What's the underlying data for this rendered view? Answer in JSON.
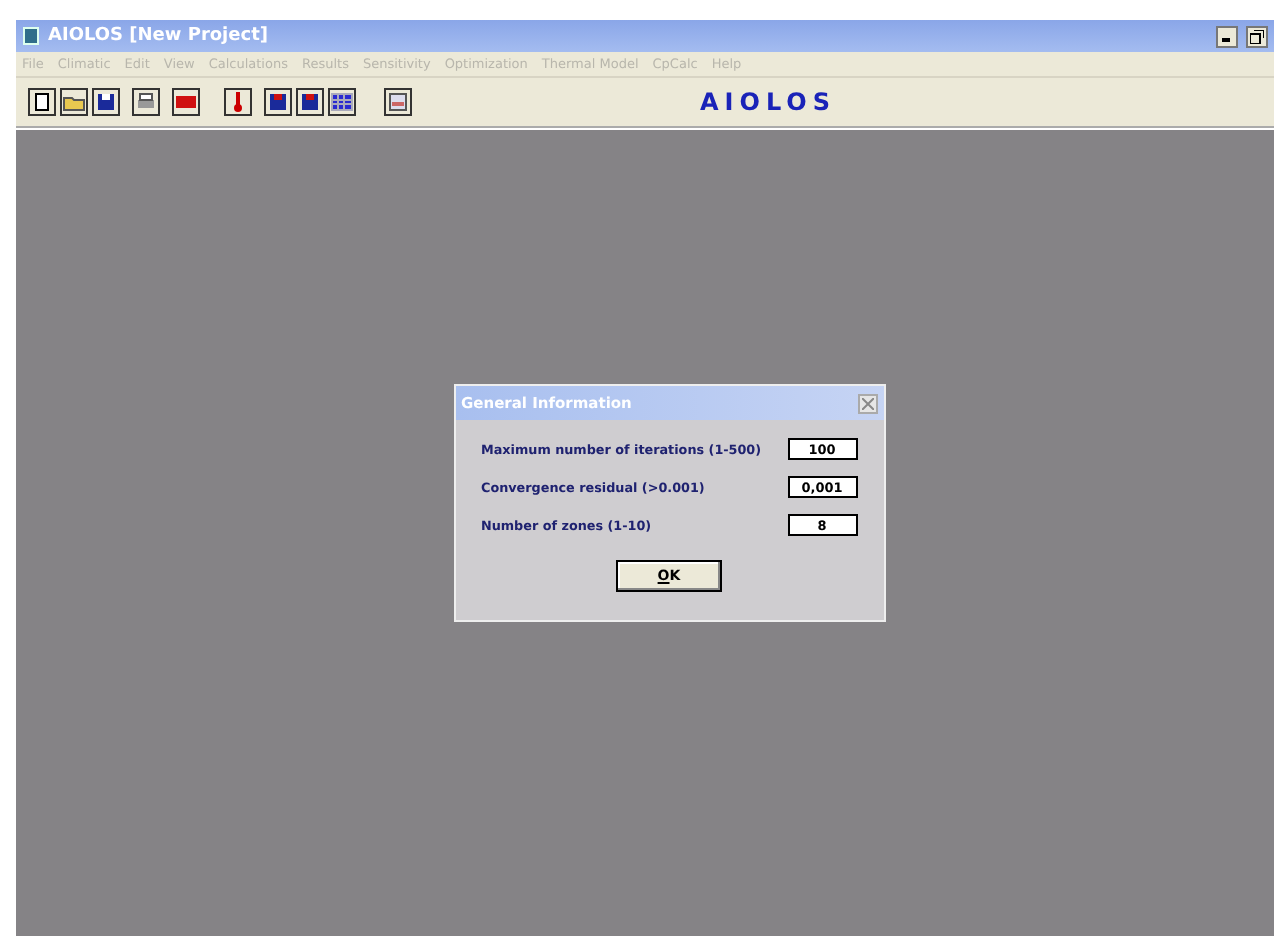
{
  "window": {
    "title": "AIOLOS [New Project]"
  },
  "menu": [
    {
      "label": "File",
      "disabled": true
    },
    {
      "label": "Climatic",
      "disabled": true
    },
    {
      "label": "Edit",
      "disabled": true
    },
    {
      "label": "View",
      "disabled": true
    },
    {
      "label": "Calculations",
      "disabled": true
    },
    {
      "label": "Results",
      "disabled": true
    },
    {
      "label": "Sensitivity",
      "disabled": true
    },
    {
      "label": "Optimization",
      "disabled": true
    },
    {
      "label": "Thermal Model",
      "disabled": true
    },
    {
      "label": "CpCalc",
      "disabled": true
    },
    {
      "label": "Help",
      "disabled": true
    }
  ],
  "toolbar": {
    "brand": "AIOLOS"
  },
  "dialog": {
    "title": "General Information",
    "fields": [
      {
        "label": "Maximum number of iterations (1-500)",
        "value": "100"
      },
      {
        "label": "Convergence residual (>0.001)",
        "value": "0,001"
      },
      {
        "label": "Number of zones (1-10)",
        "value": "8"
      }
    ],
    "button": "OK"
  }
}
